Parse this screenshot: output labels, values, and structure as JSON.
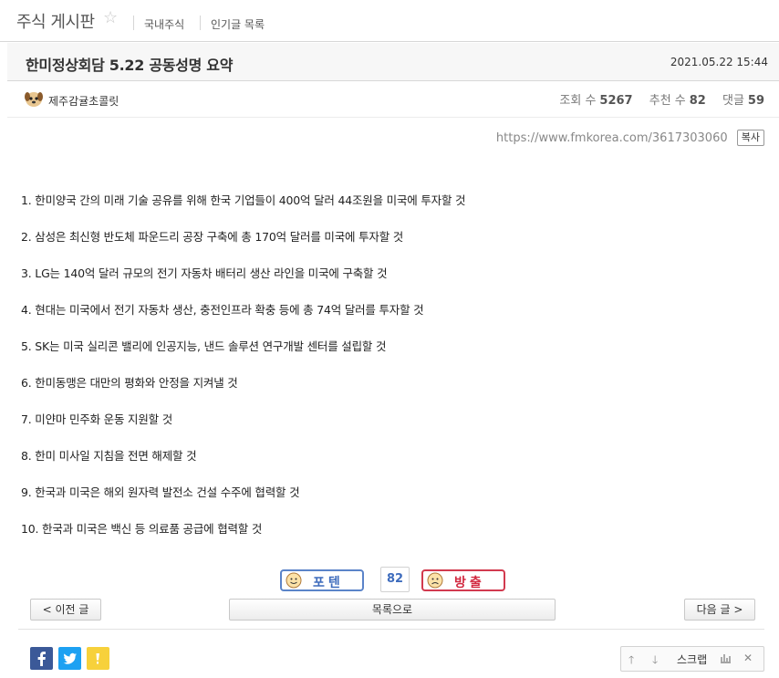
{
  "board": {
    "title": "주식 게시판",
    "links": [
      "국내주식",
      "인기글 목록"
    ]
  },
  "post": {
    "title": "한미정상회담 5.22 공동성명 요약",
    "date": "2021.05.22 15:44",
    "author": "제주감귤초콜릿",
    "stats": {
      "views_label": "조회 수",
      "views": "5267",
      "likes_label": "추천 수",
      "likes": "82",
      "comments_label": "댓글",
      "comments": "59"
    },
    "url": "https://www.fmkorea.com/3617303060",
    "copy_label": "복사",
    "lines": [
      "1. 한미양국 간의 미래 기술 공유를 위해 한국 기업들이 400억 달러 44조원을 미국에 투자할 것",
      "2. 삼성은 최신형 반도체 파운드리 공장 구축에 총 170억 달러를 미국에 투자할 것",
      "3. LG는 140억 달러 규모의 전기 자동차 배터리 생산 라인을 미국에 구축할 것",
      "4. 현대는 미국에서 전기 자동차 생산, 충전인프라 확충 등에 총 74억 달러를 투자할 것",
      "5. SK는 미국 실리콘 밸리에 인공지능, 낸드 솔루션 연구개발 센터를 설립할 것",
      "6. 한미동맹은 대만의 평화와 안정을 지켜낼 것",
      "7. 미얀마 민주화 운동 지원할 것",
      "8. 한미 미사일 지침을 전면 해제할 것",
      "9. 한국과 미국은 해외 원자력 발전소 건설 수주에 협력할 것",
      "10. 한국과 미국은 백신 등 의료품 공급에 협력할 것"
    ]
  },
  "vote": {
    "up_label": "포텐",
    "down_label": "방출",
    "count": "82",
    "up_color": "#3e6cbd",
    "down_color": "#d2283f"
  },
  "nav": {
    "prev": "< 이전 글",
    "list": "목록으로",
    "next": "다음 글 >"
  },
  "share": {
    "icons": [
      "facebook-icon",
      "twitter-icon",
      "kakaostory-icon"
    ]
  },
  "utility": {
    "scrap_label": "스크랩"
  }
}
